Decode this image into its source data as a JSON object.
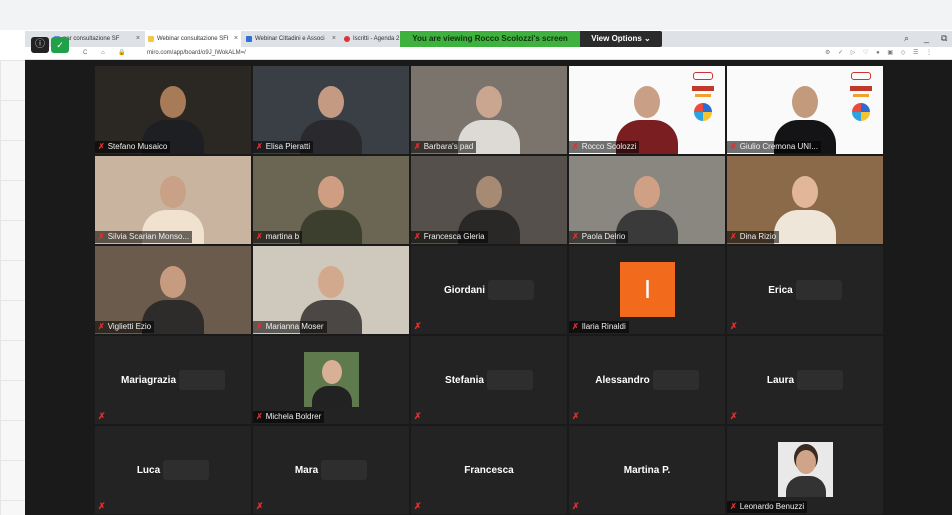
{
  "browser": {
    "tabs": [
      {
        "label": "nar consultazione SF",
        "fav": "#6b8bd6"
      },
      {
        "label": "Webinar consultazione SFI",
        "fav": "#f6c64a",
        "active": true
      },
      {
        "label": "Webinar Cittadini e Associ",
        "fav": "#2f6fd6"
      },
      {
        "label": "Iscritti - Agenda 2",
        "fav": "#d33"
      }
    ],
    "url": "miro.com/app/board/o9J_lWokALM=/",
    "close_glyph": "×"
  },
  "share_banner": {
    "text": "You are viewing Rocco Scolozzi's screen",
    "view_options": "View Options ⌄"
  },
  "participants_video": [
    {
      "name": "Stefano Musaico",
      "bg": "#2b2722",
      "skin": "#a77a58",
      "shirt": "#1e1f22"
    },
    {
      "name": "Elisa Pieratti",
      "bg": "#3a3f45",
      "skin": "#c49a82",
      "shirt": "#2a2a2e"
    },
    {
      "name": "Barbara's pad",
      "bg": "#7a746c",
      "skin": "#caa690",
      "shirt": "#dddad6"
    },
    {
      "name": "Rocco Scolozzi",
      "bg": "#fafafa",
      "skin": "#c9a085",
      "shirt": "#7a1e22",
      "logo": true
    },
    {
      "name": "Giulio Cremona UNI...",
      "bg": "#fafafa",
      "skin": "#c49a7d",
      "shirt": "#141416",
      "logo": true
    },
    {
      "name": "Silvia Scarian Monso...",
      "bg": "#c9b49f",
      "skin": "#c8a186",
      "shirt": "#f1e2cf"
    },
    {
      "name": "martina b",
      "bg": "#6b6654",
      "skin": "#cf9e82",
      "shirt": "#3c3f2d"
    },
    {
      "name": "Francesca Gleria",
      "bg": "#55504b",
      "skin": "#a78a74",
      "shirt": "#2a2827"
    },
    {
      "name": "Paola Delrio",
      "bg": "#8a8780",
      "skin": "#cfa084",
      "shirt": "#3a3a3a",
      "active": true
    },
    {
      "name": "Dina Rizio",
      "bg": "#8b6a49",
      "skin": "#e2b799",
      "shirt": "#efe6da"
    },
    {
      "name": "Viglietti Ezio",
      "bg": "#6a5b4c",
      "skin": "#c79b80",
      "shirt": "#2e2c2a"
    },
    {
      "name": "Marianna Moser",
      "bg": "#cfc8bd",
      "skin": "#d3a98e",
      "shirt": "#4a4744"
    }
  ],
  "participants_no_video": [
    {
      "name": "Giordani"
    },
    {
      "name": "Ilaria Rinaldi",
      "avatar_letter": "I"
    },
    {
      "name": "Erica"
    },
    {
      "name": "Mariagrazia"
    },
    {
      "name": "Michela Boldrer"
    },
    {
      "name": "Stefania"
    },
    {
      "name": "Alessandro"
    },
    {
      "name": "Laura"
    },
    {
      "name": "Luca"
    },
    {
      "name": "Mara"
    },
    {
      "name": "Francesca"
    },
    {
      "name": "Martina P."
    },
    {
      "name": "Leonardo Benuzzi"
    }
  ],
  "icons": {
    "muted_mic": "mic-muted-icon"
  },
  "colors": {
    "active_speaker": "#d9cf63",
    "share_green": "#3fb13f",
    "muted": "#e0302f"
  }
}
